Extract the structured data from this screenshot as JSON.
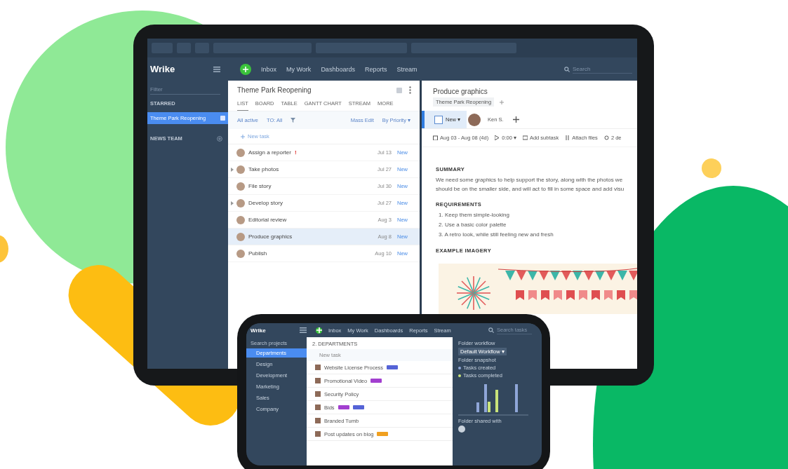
{
  "tablet": {
    "nav": {
      "logo": "Wrike",
      "items": [
        "Inbox",
        "My Work",
        "Dashboards",
        "Reports",
        "Stream"
      ],
      "search_placeholder": "Search"
    },
    "sidebar": {
      "filter_placeholder": "Filter",
      "starred_title": "STARRED",
      "starred": [
        {
          "label": "Theme Park Reopening",
          "selected": true
        }
      ],
      "team_title": "NEWS TEAM"
    },
    "list": {
      "title": "Theme Park Reopening",
      "tabs": [
        {
          "label": "LIST",
          "selected": true
        },
        {
          "label": "BOARD",
          "selected": false
        },
        {
          "label": "TABLE",
          "selected": false
        },
        {
          "label": "GANTT CHART",
          "selected": false
        },
        {
          "label": "STREAM",
          "selected": false
        },
        {
          "label": "MORE",
          "selected": false
        }
      ],
      "filters": {
        "status": "All active",
        "assignee": "TO: All",
        "mass_edit": "Mass Edit",
        "sort": "By Priority ▾"
      },
      "new_task": "New task",
      "tasks": [
        {
          "name": "Assign a reporter",
          "priority_mark": "!",
          "date": "Jul 13",
          "status": "New",
          "expandable": false,
          "selected": false
        },
        {
          "name": "Take photos",
          "date": "Jul 27",
          "status": "New",
          "expandable": true,
          "selected": false
        },
        {
          "name": "File story",
          "date": "Jul 30",
          "status": "New",
          "expandable": false,
          "selected": false
        },
        {
          "name": "Develop story",
          "date": "Jul 27",
          "status": "New",
          "expandable": true,
          "selected": false
        },
        {
          "name": "Editorial review",
          "date": "Aug 3",
          "status": "New",
          "expandable": false,
          "selected": false
        },
        {
          "name": "Produce graphics",
          "date": "Aug 8",
          "status": "New",
          "expandable": false,
          "selected": true
        },
        {
          "name": "Publish",
          "date": "Aug 10",
          "status": "New",
          "expandable": false,
          "selected": false
        }
      ]
    },
    "detail": {
      "title": "Produce graphics",
      "folder": "Theme Park Reopening",
      "status": "New ▾",
      "assignee": "Ken S.",
      "meta": [
        "Aug 03 - Aug 08 (4d)",
        "0:00 ▾",
        "Add subtask",
        "Attach files",
        "2 de"
      ],
      "sections": [
        {
          "kind": "paragraph",
          "heading": "SUMMARY",
          "lines": [
            "We need some graphics to help support the story, along with the photos we",
            "should be on the smaller side, and will act to fill in some space and add visu"
          ]
        },
        {
          "kind": "list",
          "heading": "REQUIREMENTS",
          "lines": [
            "1. Keep them simple-looking",
            "2. Use a basic color palette",
            "3. A retro look, while still feeling new and fresh"
          ]
        },
        {
          "kind": "image",
          "heading": "EXAMPLE IMAGERY"
        }
      ]
    }
  },
  "phone": {
    "nav": {
      "logo": "Wrike",
      "items": [
        "Inbox",
        "My Work",
        "Dashboards",
        "Reports",
        "Stream"
      ],
      "search_placeholder": "Search tasks"
    },
    "sidebar": {
      "search_placeholder": "Search projects",
      "items": [
        {
          "label": "Departments",
          "selected": true
        },
        {
          "label": "Design",
          "selected": false
        },
        {
          "label": "Development",
          "selected": false
        },
        {
          "label": "Marketing",
          "selected": false
        },
        {
          "label": "Sales",
          "selected": false
        },
        {
          "label": "Company",
          "selected": false
        }
      ]
    },
    "list": {
      "title": "2. DEPARTMENTS",
      "new_task": "New task",
      "rows": [
        {
          "name": "Website License Process",
          "tags": [
            {
              "color": "#5563d6"
            }
          ]
        },
        {
          "name": "Promotional Video",
          "tags": [
            {
              "color": "#a23fcf"
            }
          ]
        },
        {
          "name": "Security Policy",
          "tags": []
        },
        {
          "name": "Bids",
          "tags": [
            {
              "color": "#a23fcf"
            },
            {
              "color": "#5563d6"
            }
          ]
        },
        {
          "name": "Branded Tumb",
          "tags": []
        },
        {
          "name": "Post updates on blog",
          "tags": [
            {
              "color": "#f0a020"
            }
          ]
        }
      ]
    },
    "panel": {
      "workflow_title": "Folder workflow",
      "workflow": "Default Workflow ▾",
      "snapshot_title": "Folder snapshot",
      "legend": [
        {
          "label": "Tasks created",
          "color": "#8fa6d8"
        },
        {
          "label": "Tasks completed",
          "color": "#c9e37a"
        }
      ],
      "shared_title": "Folder shared with"
    }
  }
}
